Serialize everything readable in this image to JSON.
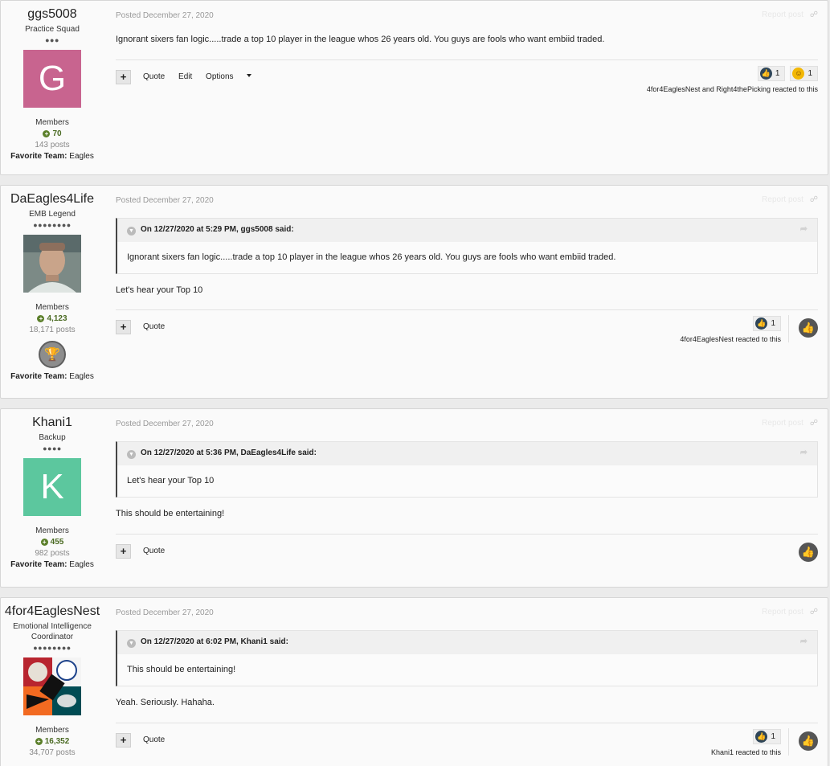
{
  "posts": [
    {
      "author": {
        "name": "ggs5008",
        "rank": "Practice Squad",
        "pips": "●●●",
        "avatar_letter": "G",
        "avatar_color": "#c8648f",
        "group": "Members",
        "reputation": "70",
        "posts": "143 posts",
        "fav_label": "Favorite Team:",
        "fav_value": "Eagles"
      },
      "posted": "Posted December 27, 2020",
      "report": "Report post",
      "body": "Ignorant sixers fan logic.....trade a top 10 player in the league whos 26 years old. You guys are fools who want embiid traded.",
      "controls": {
        "plus": "+",
        "quote": "Quote",
        "edit": "Edit",
        "options": "Options"
      },
      "reactions": [
        {
          "icon": "like-icon",
          "count": "1"
        },
        {
          "icon": "haha-icon",
          "count": "1"
        }
      ],
      "reacted_by": "4for4EaglesNest and Right4thePicking reacted to this"
    },
    {
      "author": {
        "name": "DaEagles4Life",
        "rank": "EMB Legend",
        "pips": "●●●●●●●●",
        "group": "Members",
        "reputation": "4,123",
        "posts": "18,171 posts",
        "fav_label": "Favorite Team:",
        "fav_value": "Eagles"
      },
      "posted": "Posted December 27, 2020",
      "report": "Report post",
      "quote": {
        "header": "On 12/27/2020 at 5:29 PM, ggs5008 said:",
        "text": "Ignorant sixers fan logic.....trade a top 10 player in the league whos 26 years old. You guys are fools who want embiid traded."
      },
      "body": "Let's hear your Top 10",
      "controls": {
        "plus": "+",
        "quote": "Quote"
      },
      "reactions": [
        {
          "icon": "like-icon",
          "count": "1"
        }
      ],
      "reacted_by": "4for4EaglesNest reacted to this"
    },
    {
      "author": {
        "name": "Khani1",
        "rank": "Backup",
        "pips": "●●●●",
        "avatar_letter": "K",
        "avatar_color": "#5cc79e",
        "group": "Members",
        "reputation": "455",
        "posts": "982 posts",
        "fav_label": "Favorite Team:",
        "fav_value": "Eagles"
      },
      "posted": "Posted December 27, 2020",
      "report": "Report post",
      "quote": {
        "header": "On 12/27/2020 at 5:36 PM, DaEagles4Life said:",
        "text": "Let's hear your Top 10"
      },
      "body": "This should be entertaining!",
      "controls": {
        "plus": "+",
        "quote": "Quote"
      }
    },
    {
      "author": {
        "name": "4for4EaglesNest",
        "rank": "Emotional Intelligence Coordinator",
        "pips": "●●●●●●●●",
        "group": "Members",
        "reputation": "16,352",
        "posts": "34,707 posts"
      },
      "posted": "Posted December 27, 2020",
      "report": "Report post",
      "quote": {
        "header": "On 12/27/2020 at 6:02 PM, Khani1 said:",
        "text": "This should be entertaining!"
      },
      "body": "Yeah.  Seriously.  Hahaha.",
      "controls": {
        "plus": "+",
        "quote": "Quote"
      },
      "reactions": [
        {
          "icon": "like-icon",
          "count": "1"
        }
      ],
      "reacted_by": "Khani1 reacted to this"
    }
  ]
}
